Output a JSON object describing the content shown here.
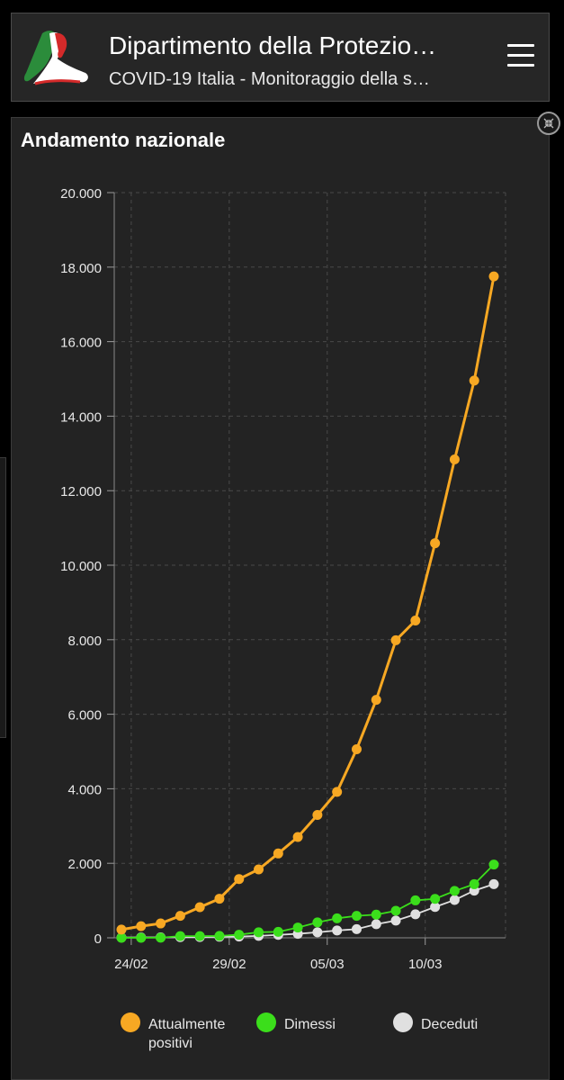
{
  "header": {
    "title": "Dipartimento della Protezio…",
    "subtitle": "COVID-19 Italia - Monitoraggio della s…"
  },
  "panel": {
    "title": "Andamento nazionale"
  },
  "colors": {
    "positivi": "#f7a823",
    "dimessi": "#3bde1b",
    "deceduti": "#e0e0e0",
    "background": "#232323"
  },
  "chart_data": {
    "type": "line",
    "x": [
      "24/02",
      "25/02",
      "26/02",
      "27/02",
      "28/02",
      "29/02",
      "01/03",
      "02/03",
      "03/03",
      "04/03",
      "05/03",
      "06/03",
      "07/03",
      "08/03",
      "09/03",
      "10/03",
      "11/03",
      "12/03",
      "13/03",
      "14/03"
    ],
    "x_tick_labels": [
      "24/02",
      "29/02",
      "05/03",
      "10/03"
    ],
    "y_tick_labels": [
      "0",
      "2.000",
      "4.000",
      "6.000",
      "8.000",
      "10.000",
      "12.000",
      "14.000",
      "16.000",
      "18.000",
      "20.000"
    ],
    "ylim": [
      0,
      20000
    ],
    "grid": true,
    "legend_position": "bottom",
    "series": [
      {
        "name": "Attualmente positivi",
        "color_key": "positivi",
        "values": [
          221,
          311,
          385,
          588,
          821,
          1049,
          1577,
          1835,
          2263,
          2706,
          3296,
          3916,
          5061,
          6387,
          7985,
          8514,
          10590,
          12839,
          14955,
          17750
        ]
      },
      {
        "name": "Dimessi",
        "color_key": "dimessi",
        "values": [
          1,
          1,
          3,
          45,
          46,
          50,
          83,
          149,
          160,
          276,
          414,
          523,
          589,
          622,
          724,
          1004,
          1045,
          1258,
          1439,
          1966
        ]
      },
      {
        "name": "Deceduti",
        "color_key": "deceduti",
        "values": [
          7,
          10,
          12,
          17,
          21,
          29,
          34,
          52,
          79,
          107,
          148,
          197,
          233,
          366,
          463,
          631,
          827,
          1016,
          1266,
          1441
        ]
      }
    ]
  }
}
